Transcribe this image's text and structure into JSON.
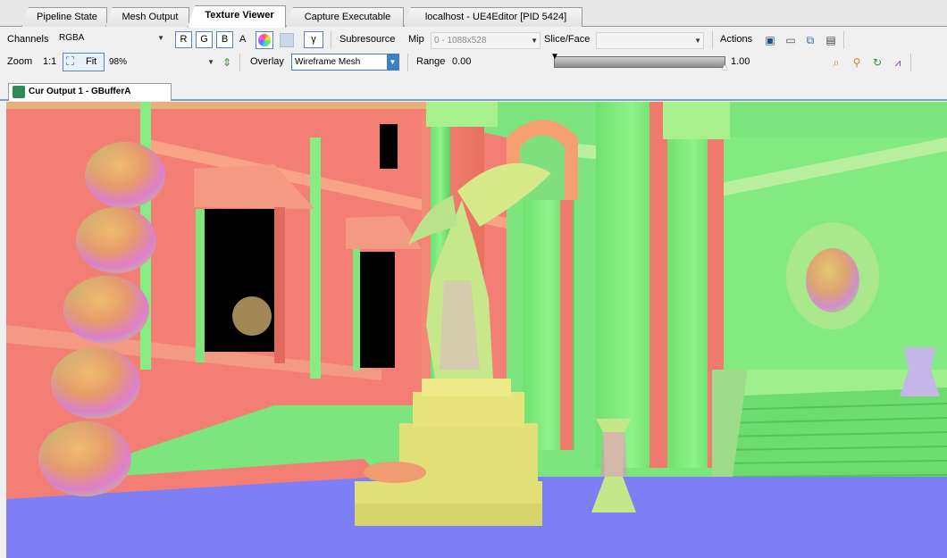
{
  "tabs": [
    {
      "label": "Pipeline State"
    },
    {
      "label": "Mesh Output"
    },
    {
      "label": "Texture Viewer"
    },
    {
      "label": "Capture Executable"
    },
    {
      "label": "localhost - UE4Editor [PID 5424]"
    }
  ],
  "toolbar1": {
    "channels_label": "Channels",
    "channels_value": "RGBA",
    "r": "R",
    "g": "G",
    "b": "B",
    "a": "A",
    "gamma": "γ",
    "subresource_label": "Subresource",
    "mip_label": "Mip",
    "mip_value": "0 - 1088x528",
    "slice_label": "Slice/Face",
    "slice_value": "",
    "actions_label": "Actions"
  },
  "toolbar2": {
    "zoom_label": "Zoom",
    "zoom_ratio": "1:1",
    "fit_label": "Fit",
    "zoom_value": "98%",
    "overlay_label": "Overlay",
    "overlay_value": "Wireframe Mesh",
    "range_label": "Range",
    "range_min": "0.00",
    "range_max": "1.00"
  },
  "document_tab": {
    "label": "Cur Output 1 - GBufferA"
  },
  "colors": {
    "accent": "#3a6ea5",
    "normal_red": "#f37f74",
    "normal_green": "#79e87a",
    "normal_blue": "#7f7ff5",
    "normal_yellow": "#e0df78"
  },
  "icons": [
    "rgb-color-wheel-icon",
    "save-icon",
    "export-icon",
    "open-icon",
    "view-icon",
    "zoom-icon",
    "pick-icon",
    "reset-icon",
    "histogram-icon",
    "fit-icon",
    "flip-icon"
  ]
}
